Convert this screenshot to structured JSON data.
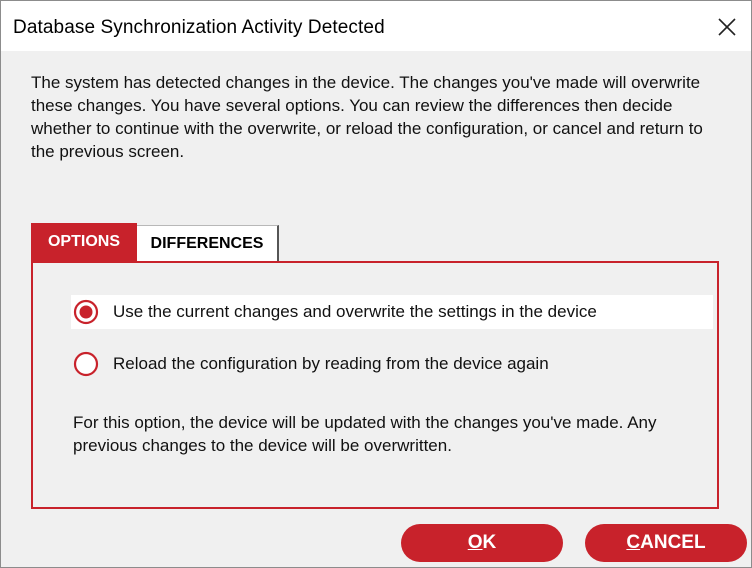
{
  "window": {
    "title": "Database Synchronization Activity Detected",
    "close_icon": "close-icon"
  },
  "description": "The system has detected changes in the device.  The changes you've made will overwrite these changes.  You have several options.  You can review the differences then decide whether to continue with the overwrite, or reload the configuration, or cancel and return to the previous screen.",
  "tabs": [
    {
      "label": "OPTIONS",
      "active": true
    },
    {
      "label": "DIFFERENCES",
      "active": false
    }
  ],
  "options": [
    {
      "label": "Use the current changes and overwrite the settings in the device",
      "selected": true
    },
    {
      "label": "Reload the configuration by reading from the device again",
      "selected": false
    }
  ],
  "option_note": "For this option, the device will be updated with the changes you've made.  Any previous changes to the device will be overwritten.",
  "buttons": {
    "ok": "OK",
    "cancel": "CANCEL"
  },
  "colors": {
    "accent": "#c8222b",
    "background": "#f0f0f0",
    "titlebar": "#ffffff"
  }
}
